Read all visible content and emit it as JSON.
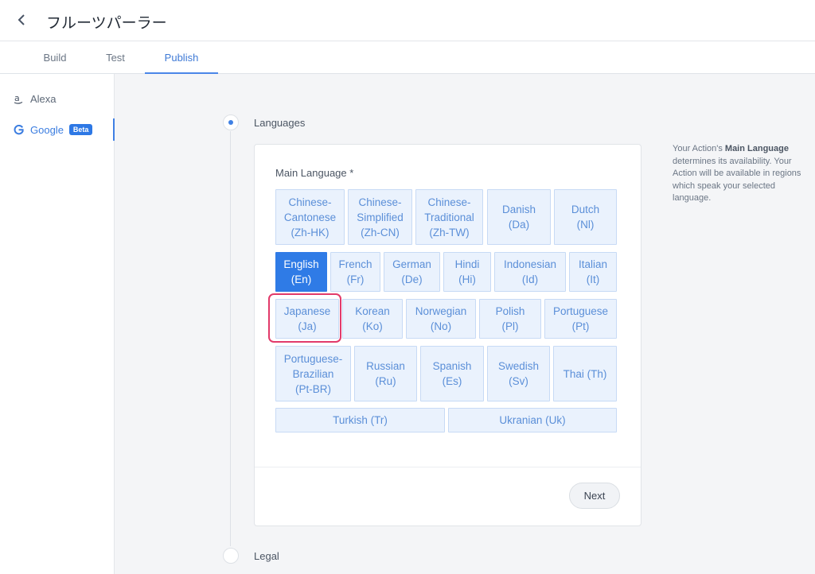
{
  "header": {
    "title": "フルーツパーラー",
    "back_icon": "chevron-left-icon"
  },
  "tabs": [
    {
      "label": "Build",
      "active": false
    },
    {
      "label": "Test",
      "active": false
    },
    {
      "label": "Publish",
      "active": true
    }
  ],
  "sidebar": {
    "items": [
      {
        "label": "Alexa",
        "icon": "amazon-icon",
        "active": false
      },
      {
        "label": "Google",
        "icon": "google-icon",
        "badge": "Beta",
        "active": true
      }
    ]
  },
  "steps": [
    {
      "label": "Languages",
      "active": true
    },
    {
      "label": "Legal",
      "active": false
    }
  ],
  "card": {
    "field_label": "Main Language *",
    "languages": [
      {
        "label": "Chinese-\nCantonese\n(Zh-HK)",
        "selected": false
      },
      {
        "label": "Chinese-\nSimplified\n(Zh-CN)",
        "selected": false
      },
      {
        "label": "Chinese-\nTraditional\n(Zh-TW)",
        "selected": false
      },
      {
        "label": "Danish\n(Da)",
        "selected": false
      },
      {
        "label": "Dutch\n(Nl)",
        "selected": false
      },
      {
        "label": "English\n(En)",
        "selected": true
      },
      {
        "label": "French\n(Fr)",
        "selected": false
      },
      {
        "label": "German\n(De)",
        "selected": false
      },
      {
        "label": "Hindi\n(Hi)",
        "selected": false
      },
      {
        "label": "Indonesian\n(Id)",
        "selected": false
      },
      {
        "label": "Italian\n(It)",
        "selected": false
      },
      {
        "label": "Japanese\n(Ja)",
        "selected": false
      },
      {
        "label": "Korean\n(Ko)",
        "selected": false
      },
      {
        "label": "Norwegian\n(No)",
        "selected": false
      },
      {
        "label": "Polish\n(Pl)",
        "selected": false
      },
      {
        "label": "Portuguese\n(Pt)",
        "selected": false
      },
      {
        "label": "Portuguese-\nBrazilian\n(Pt-BR)",
        "selected": false
      },
      {
        "label": "Russian\n(Ru)",
        "selected": false
      },
      {
        "label": "Spanish\n(Es)",
        "selected": false
      },
      {
        "label": "Swedish\n(Sv)",
        "selected": false
      },
      {
        "label": "Thai (Th)",
        "selected": false
      },
      {
        "label": "Turkish (Tr)",
        "selected": false
      },
      {
        "label": "Ukranian (Uk)",
        "selected": false
      }
    ],
    "next_label": "Next"
  },
  "help": {
    "prefix": "Your Action's ",
    "strong": "Main Language",
    "suffix": " determines its availability. Your Action will be available in regions which speak your selected language."
  },
  "colors": {
    "accent": "#3f80e4",
    "selected": "#2f7be6",
    "highlight": "#e23a6a"
  }
}
